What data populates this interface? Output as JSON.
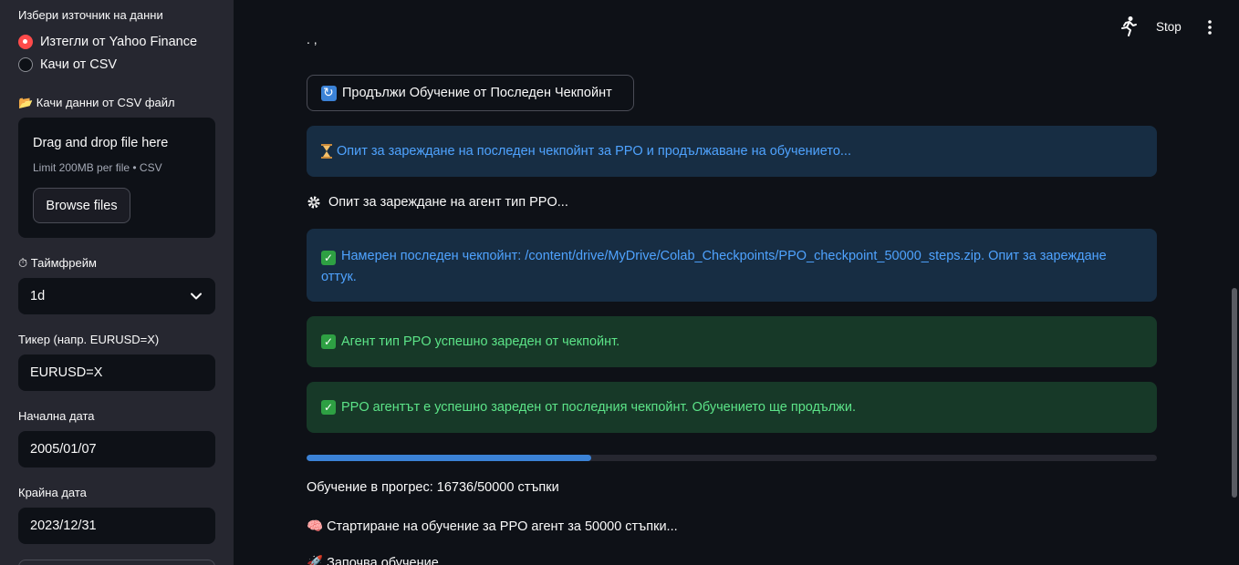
{
  "sidebar": {
    "source_label": "Избери източник на данни",
    "source_options": [
      "Изтегли от Yahoo Finance",
      "Качи от CSV"
    ],
    "source_selected": "Изтегли от Yahoo Finance",
    "csv_label": "📂 Качи данни от CSV файл",
    "uploader": {
      "title": "Drag and drop file here",
      "subtitle": "Limit 200MB per file • CSV",
      "button": "Browse files"
    },
    "timeframe_label": "⏱ Таймфрейм",
    "timeframe_value": "1d",
    "ticker_label": "Тикер (напр. EURUSD=X)",
    "ticker_value": "EURUSD=X",
    "start_label": "Начална дата",
    "start_value": "2005/01/07",
    "end_label": "Крайна дата",
    "end_value": "2023/12/31"
  },
  "header": {
    "stop_label": "Stop",
    "running_icon": "running-man-icon",
    "menu_icon": "kebab-menu-icon"
  },
  "main": {
    "cut_text": ". ,",
    "resume_button": "Продължи Обучение от Последен Чекпойнт",
    "info_loading": "Опит за зареждане на последен чекпойнт за PPO и продължаване на обучението...",
    "agent_loading": "Опит за зареждане на агент тип PPO...",
    "info_found": "Намерен последен чекпойнт: /content/drive/MyDrive/Colab_Checkpoints/PPO_checkpoint_50000_steps.zip. Опит за зареждане оттук.",
    "success_agent": "Агент тип PPO успешно зареден от чекпойнт.",
    "success_resume": "PPO агентът е успешно зареден от последния чекпойнт. Обучението ще продължи.",
    "progress": {
      "current": 16736,
      "total": 50000,
      "fraction": 0.3347
    },
    "progress_text": "Обучение в прогрес: 16736/50000 стъпки",
    "start_training": "🧠 Стартиране на обучение за PPO агент за 50000 стъпки...",
    "begins_training": "🚀 Започва обучение..."
  },
  "colors": {
    "accent": "#ff4b4b",
    "info_bg": "#172d43",
    "info_text": "#4fa3ff",
    "success_bg": "#173928",
    "success_text": "#5ce488",
    "progress": "#3b82d6"
  }
}
